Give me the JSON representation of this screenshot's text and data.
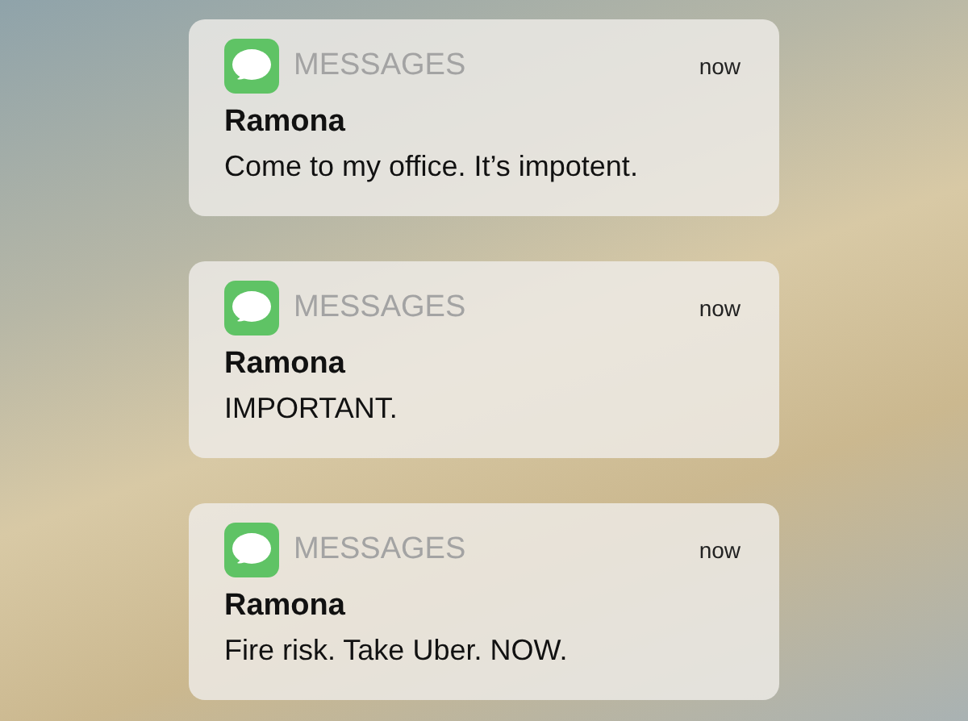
{
  "notifications": [
    {
      "app": "MESSAGES",
      "time": "now",
      "sender": "Ramona",
      "message": "Come to my office. It’s impotent."
    },
    {
      "app": "MESSAGES",
      "time": "now",
      "sender": "Ramona",
      "message": "IMPORTANT."
    },
    {
      "app": "MESSAGES",
      "time": "now",
      "sender": "Ramona",
      "message": "Fire risk. Take Uber. NOW."
    }
  ]
}
